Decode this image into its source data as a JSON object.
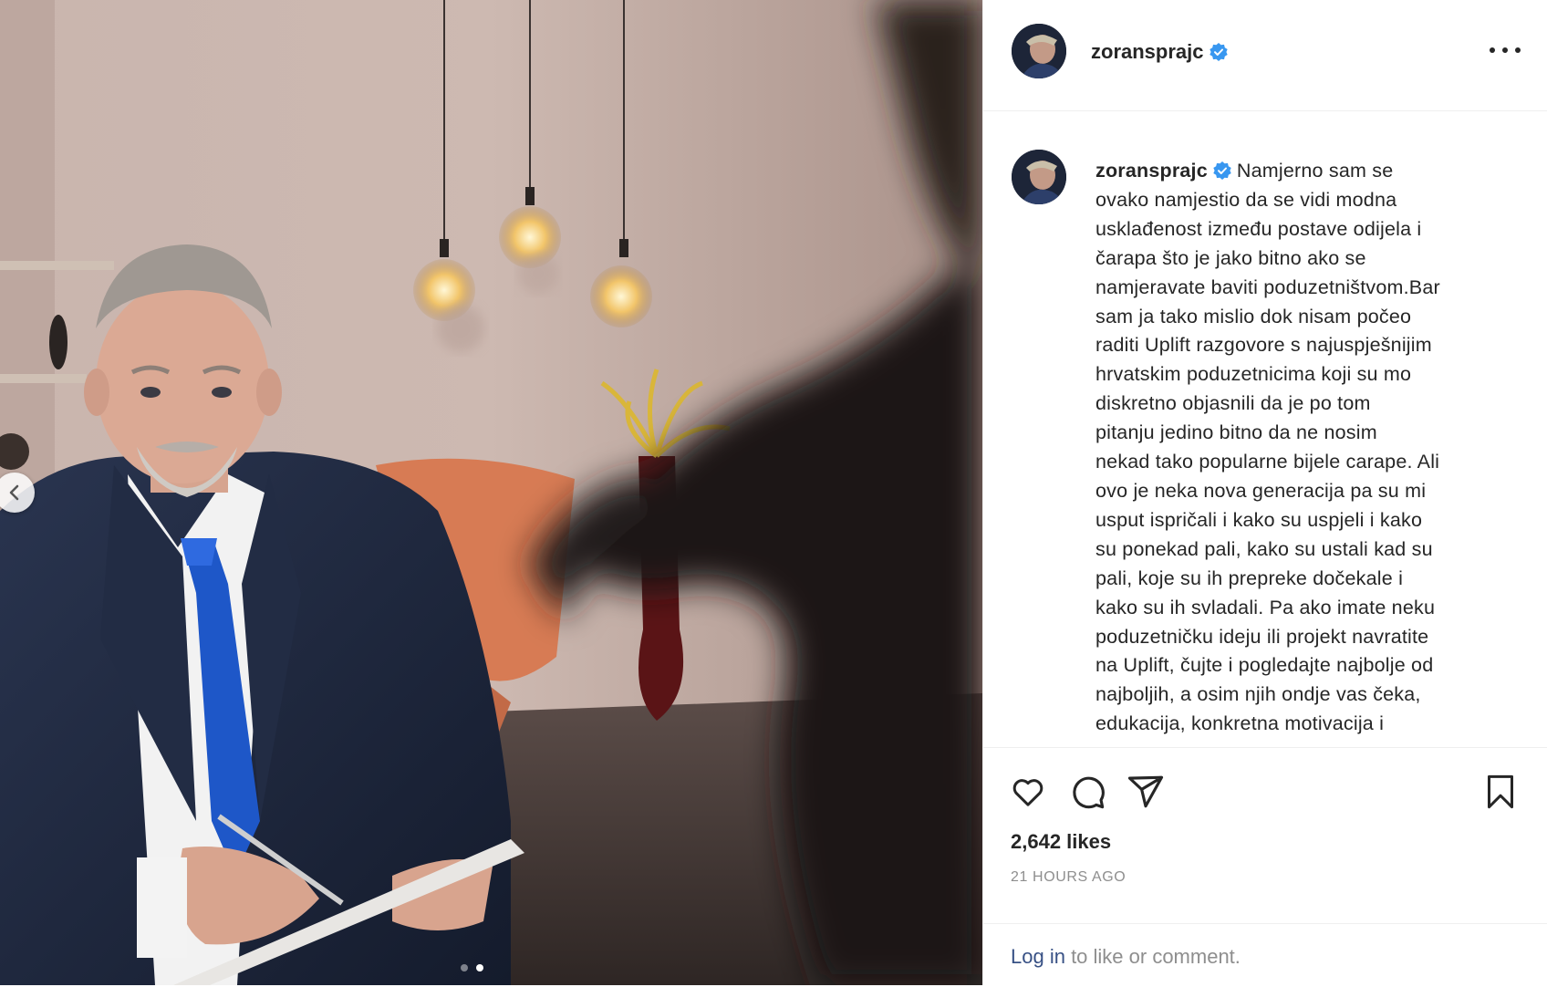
{
  "post": {
    "username": "zoransprajc",
    "more_icon": "more-horizontal-icon",
    "verified_icon": "verified-badge-icon",
    "caption": {
      "lines": [
        "Namjerno sam se",
        "ovako namjestio da se vidi modna",
        "usklađenost između postave odijela i",
        "čarapa što je jako bitno ako se",
        "namjeravate baviti poduzetništvom.Bar",
        "sam ja tako mislio dok nisam počeo",
        "raditi Uplift razgovore s najuspješnijim",
        "hrvatskim poduzetnicima koji su mo",
        "diskretno objasnili da je po tom",
        "pitanju jedino bitno da ne nosim",
        "nekad tako popularne bijele carape. Ali",
        "ovo je neka nova generacija pa su mi",
        "usput ispričali i kako su uspjeli i kako",
        "su ponekad pali, kako su ustali kad su",
        "pali, koje su ih prepreke dočekale i",
        "kako su ih svladali. Pa ako imate neku",
        "poduzetničku ideju ili projekt navratite",
        "na Uplift, čujte i pogledajte najbolje od",
        "najboljih, a osim njih ondje vas čeka,",
        "edukacija, konkretna motivacija i"
      ]
    },
    "likes": "2,642 likes",
    "time_ago": "21 HOURS AGO",
    "comment": {
      "login_link": "Log in",
      "prompt": " to like or comment."
    },
    "icons": [
      "heart-icon",
      "comment-icon",
      "share-icon",
      "bookmark-icon"
    ],
    "carousel": {
      "current": 2,
      "total": 2
    }
  },
  "colors": {
    "verified": "#3897f0",
    "link": "#385185",
    "muted": "#8e8e8e",
    "text": "#262626"
  }
}
